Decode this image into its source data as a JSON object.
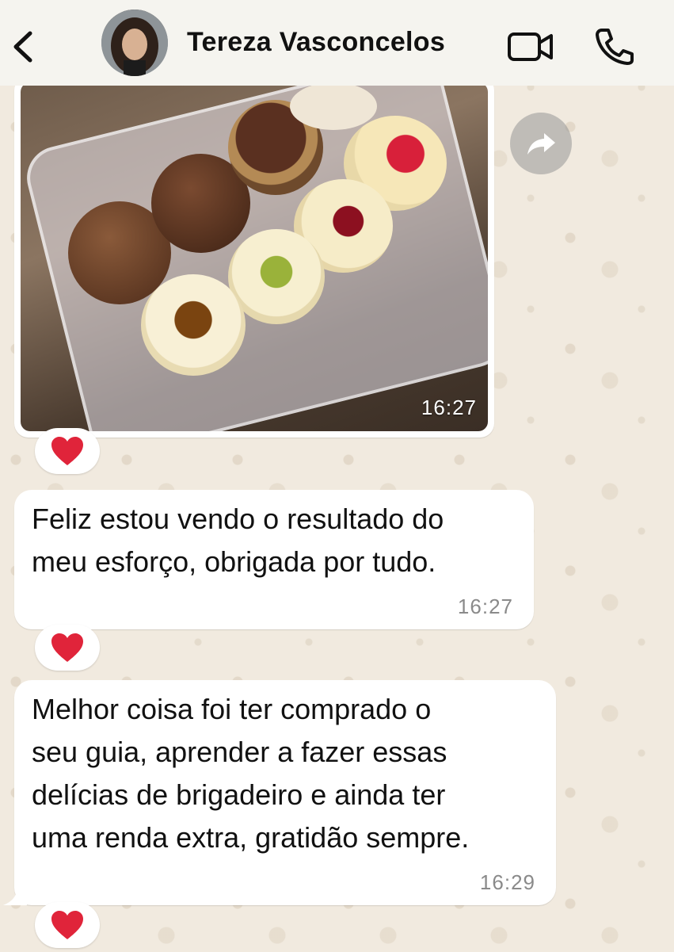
{
  "header": {
    "contact_name": "Tereza Vasconcelos",
    "back_icon": "chevron-left-icon",
    "video_icon": "video-camera-icon",
    "phone_icon": "phone-icon"
  },
  "messages": [
    {
      "type": "image",
      "content": "photo of brigadeiros in a clear plastic tray",
      "time": "16:27",
      "reaction": "❤️"
    },
    {
      "type": "text",
      "text": "Feliz estou vendo o resultado do\nmeu esforço, obrigada por tudo.",
      "time": "16:27",
      "reaction": "❤️"
    },
    {
      "type": "text",
      "text": "Melhor coisa foi ter comprado o\nseu guia, aprender a fazer essas\ndelícias de brigadeiro e ainda ter\numa renda extra, gratidão sempre.",
      "time": "16:29",
      "reaction": "❤️"
    }
  ],
  "colors": {
    "header_bg": "#f5f4ef",
    "bubble_bg": "#ffffff",
    "wallpaper": "#f1eadf",
    "time_gray": "#8a8a8a",
    "heart_red": "#e0243a"
  }
}
